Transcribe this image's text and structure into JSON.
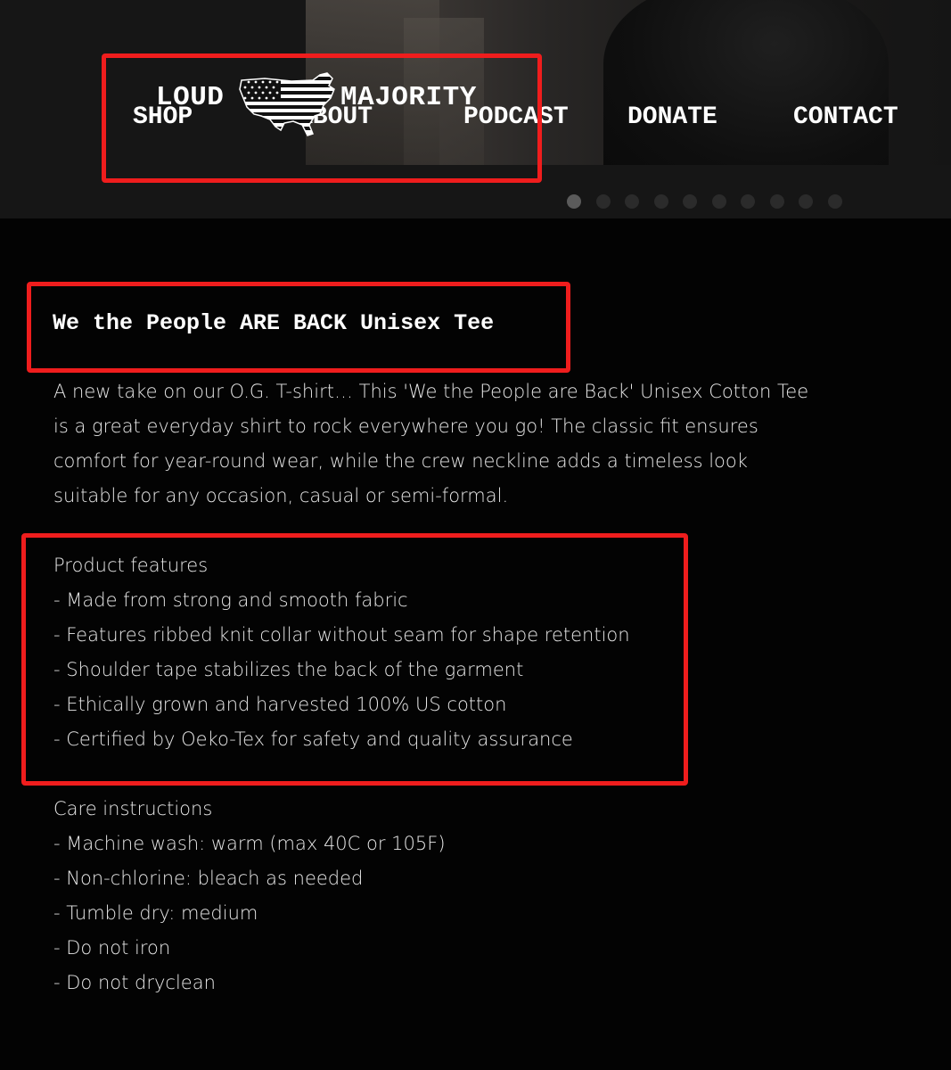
{
  "header": {
    "logo": {
      "left_text": "LOUD",
      "right_text": "MAJORITY",
      "emblem": "usa-flag-map-icon"
    },
    "nav": [
      "SHOP",
      "ABOUT",
      "PODCAST",
      "DONATE",
      "CONTACT"
    ],
    "carousel": {
      "slide_count": 10,
      "active_index": 0
    }
  },
  "product": {
    "title": "We the People ARE BACK Unisex Tee",
    "description_lines": [
      "A new take on our O.G. T-shirt… This 'We the People are Back' Unisex Cotton Tee",
      "is a great everyday shirt to rock everywhere you go! The classic fit ensures",
      "comfort for year-round wear, while the crew neckline adds a timeless look",
      "suitable for any occasion, casual or semi-formal."
    ],
    "features": {
      "heading": "Product features",
      "items": [
        "- Made from strong and smooth fabric",
        "- Features ribbed knit collar without seam for shape retention",
        "- Shoulder tape stabilizes the back of the garment",
        "- Ethically grown and harvested 100% US cotton",
        "- Certified by Oeko-Tex for safety and quality assurance"
      ]
    },
    "care": {
      "heading": "Care instructions",
      "items": [
        "- Machine wash: warm (max 40C or 105F)",
        "- Non-chlorine: bleach as needed",
        "- Tumble dry: medium",
        "- Do not iron",
        "- Do not dryclean"
      ]
    }
  },
  "colors": {
    "background": "#030303",
    "header_background": "#161616",
    "highlight_box": "#ef1d1d",
    "text": "#e6e6e6",
    "dot_inactive": "#2b2b2b",
    "dot_active": "#5b5b5b"
  }
}
